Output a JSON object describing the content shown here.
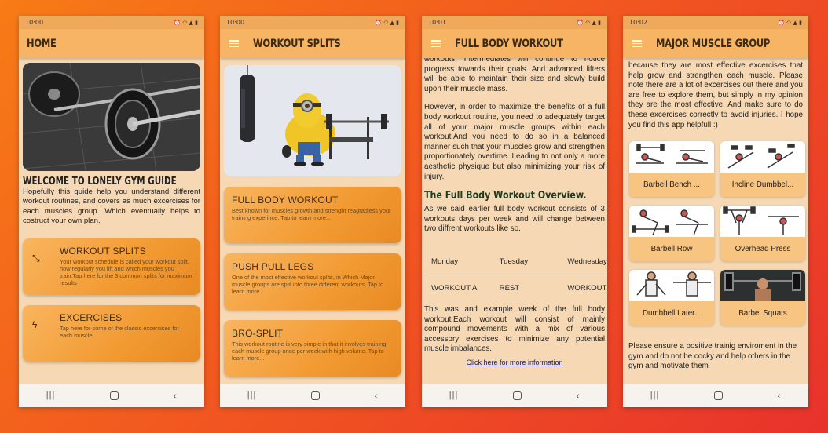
{
  "phones": [
    {
      "time": "10:00",
      "title": "HOME",
      "welcome": "WELCOME TO LONELY GYM GUIDE",
      "intro": "Hopefully this guide help you understand different workout routines, and covers as much excercises for each muscles group. Which eventually helps to costruct your own plan.",
      "cards": [
        {
          "title": "WORKOUT SPLITS",
          "desc": "Your workout schedule is called your workout split, how regularly you lift and which muscles you train.Tap here for the 3 common splits for maximum results",
          "icon": "arrows-expand-icon"
        },
        {
          "title": "EXCERCISES",
          "desc": "Tap here for some of the classic excercises for each muscle",
          "icon": "lightning-icon"
        }
      ]
    },
    {
      "time": "10:00",
      "title": "WORKOUT SPLITS",
      "cards": [
        {
          "title": "FULL BODY WORKOUT",
          "desc": "Best known for muscles growth and strenght reagradless your training experince. Tap to learn more..."
        },
        {
          "title": "PUSH PULL LEGS",
          "desc": "One of the most effective workout splits, in Which Major muscle groups are split into three different workouts. Tap to learn more..."
        },
        {
          "title": "BRO-SPLIT",
          "desc": "This workout routine is very simple in that it involves training each muscle group once per week with high volume. Tap to learn more..."
        }
      ]
    },
    {
      "time": "10:01",
      "title": "FULL BODY WORKOUT",
      "para1": "workouts. Intermediates will continue to notice progress towards their goals. And advanced lifters will be able to maintain their size and slowly build upon their muscle mass.",
      "para2": "However, in order to maximize the benefits of a full body workout routine, you need to adequately target all of your major muscle groups within each workout.And you need to do so in a balanced manner such that your muscles grow and strengthen proportionately overtime. Leading to not only a more aesthetic physique but also minimizing your risk of injury.",
      "overview_title": "The Full Body Workout Overview.",
      "para3": "As we said earlier full body workout consists of 3 workouts days per week and will change between two diffrent workouts like so.",
      "schedule_headers": [
        "Monday",
        "Tuesday",
        "Wednesday"
      ],
      "schedule_values": [
        "WORKOUT A",
        "REST",
        "WORKOUT B"
      ],
      "para4": "This was and example week of the full body workout.Each workout will consist of mainly compound movements with a mix of various accessory exercises to minimize any potential muscle imbalances.",
      "link": "Click here for more information"
    },
    {
      "time": "10:02",
      "title": "MAJOR MUSCLE GROUP",
      "intro": "because they are most effective excercises that help grow and strengthen each muscle. Please note there are a lot of excercises out there and you are free to explore them, but simply in my opinion they are the most effective. And make sure to do these excercises correctly to avoid injuries. I hope you find this app helpfull :)",
      "exercises": [
        "Barbell Bench ...",
        "Incline Dumbbel...",
        "Barbell Row",
        "Overhead Press",
        "Dumbbell Later...",
        "Barbel Squats"
      ],
      "footer": "Please ensure a positive trainig enviroment in the gym and do not be cocky and help others in the gym and motivate them"
    }
  ]
}
